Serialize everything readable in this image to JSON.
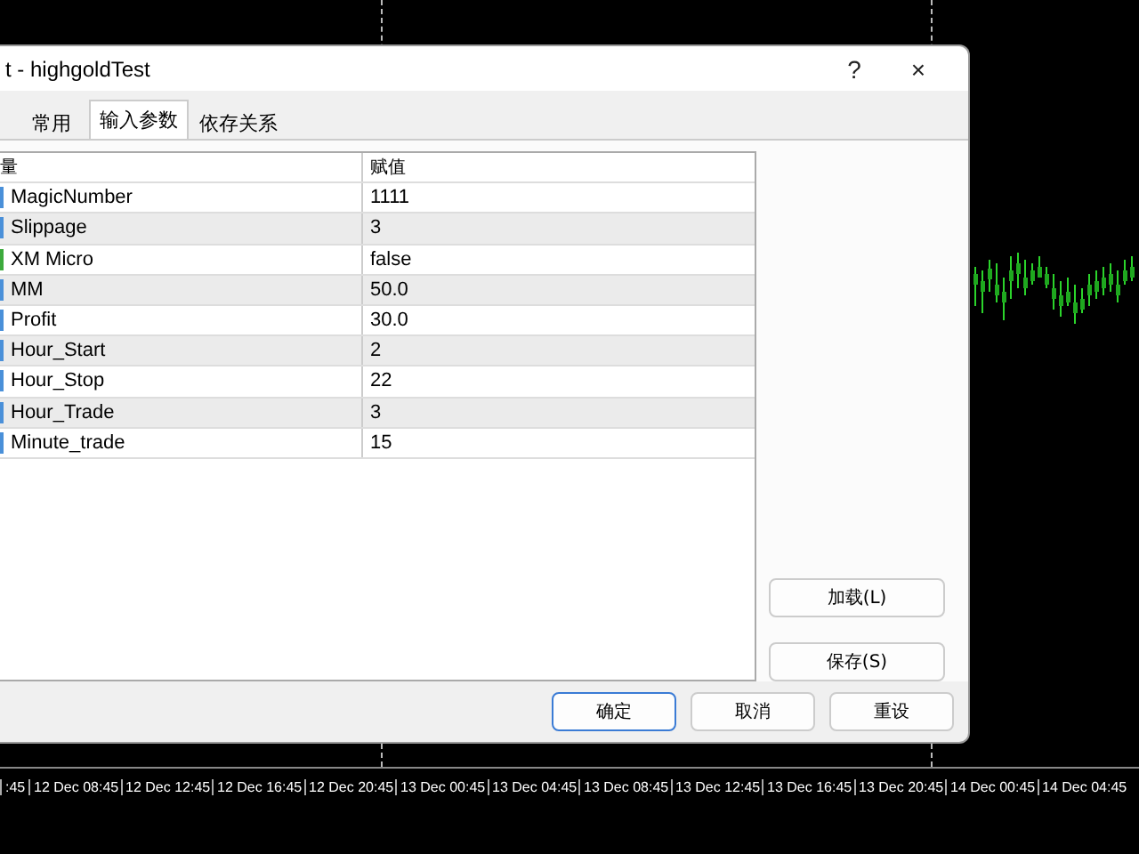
{
  "dialog": {
    "title": "t - highgoldTest",
    "help": "?",
    "close": "×"
  },
  "tabs": [
    {
      "label": "常用",
      "selected": false
    },
    {
      "label": "输入参数",
      "selected": true
    },
    {
      "label": "依存关系",
      "selected": false
    }
  ],
  "table": {
    "columns": [
      "量",
      "赋值"
    ],
    "rows": [
      {
        "kind": "number",
        "name": "MagicNumber",
        "value": "1111"
      },
      {
        "kind": "number",
        "name": "Slippage",
        "value": "3"
      },
      {
        "kind": "bool",
        "name": "XM Micro",
        "value": "false"
      },
      {
        "kind": "number",
        "name": "MM",
        "value": "50.0"
      },
      {
        "kind": "number",
        "name": "Profit",
        "value": "30.0"
      },
      {
        "kind": "number",
        "name": "Hour_Start",
        "value": "2"
      },
      {
        "kind": "number",
        "name": "Hour_Stop",
        "value": "22"
      },
      {
        "kind": "number",
        "name": "Hour_Trade",
        "value": "3"
      },
      {
        "kind": "number",
        "name": "Minute_trade",
        "value": "15"
      }
    ]
  },
  "side_buttons": [
    "加载(L)",
    "保存(S)"
  ],
  "buttons": [
    {
      "label": "确定",
      "default": true
    },
    {
      "label": "取消",
      "default": false
    },
    {
      "label": "重设",
      "default": false
    }
  ],
  "time_axis": [
    ":45",
    "12 Dec 08:45",
    "12 Dec 12:45",
    "12 Dec 16:45",
    "12 Dec 20:45",
    "13 Dec 00:45",
    "13 Dec 04:45",
    "13 Dec 08:45",
    "13 Dec 12:45",
    "13 Dec 16:45",
    "13 Dec 20:45",
    "14 Dec 00:45",
    "14 Dec 04:45"
  ]
}
